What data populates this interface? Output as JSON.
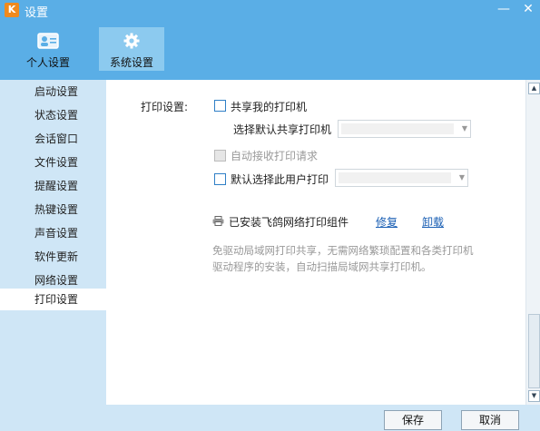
{
  "window": {
    "title": "设置",
    "minimize": "—",
    "close": "✕"
  },
  "top_tabs": [
    {
      "label": "个人设置",
      "icon": "user-card-icon",
      "active": false
    },
    {
      "label": "系统设置",
      "icon": "gear-icon",
      "active": true
    }
  ],
  "sidebar": {
    "items": [
      {
        "label": "启动设置",
        "active": false
      },
      {
        "label": "状态设置",
        "active": false
      },
      {
        "label": "会话窗口",
        "active": false
      },
      {
        "label": "文件设置",
        "active": false
      },
      {
        "label": "提醒设置",
        "active": false
      },
      {
        "label": "热键设置",
        "active": false
      },
      {
        "label": "声音设置",
        "active": false
      },
      {
        "label": "软件更新",
        "active": false
      },
      {
        "label": "网络设置",
        "active": false
      },
      {
        "label": "打印设置",
        "active": true
      }
    ]
  },
  "print": {
    "section_label": "打印设置:",
    "share_printer": {
      "label": "共享我的打印机",
      "checked": false
    },
    "default_shared_printer": {
      "label": "选择默认共享打印机",
      "value": ""
    },
    "auto_accept": {
      "label": "自动接收打印请求",
      "checked": false,
      "enabled": false
    },
    "default_user_print": {
      "label": "默认选择此用户打印",
      "checked": false,
      "value": ""
    },
    "installed": {
      "label": "已安装飞鸽网络打印组件",
      "repair": "修复",
      "uninstall": "卸载"
    },
    "description": "免驱动局域网打印共享，无需网络繁琐配置和各类打印机驱动程序的安装，自动扫描局域网共享打印机。"
  },
  "footer": {
    "save": "保存",
    "cancel": "取消"
  },
  "colors": {
    "header": "#5aaee6",
    "sidebar": "#cfe6f6",
    "active_tab": "#8ccaef",
    "link": "#1a5fb4"
  }
}
